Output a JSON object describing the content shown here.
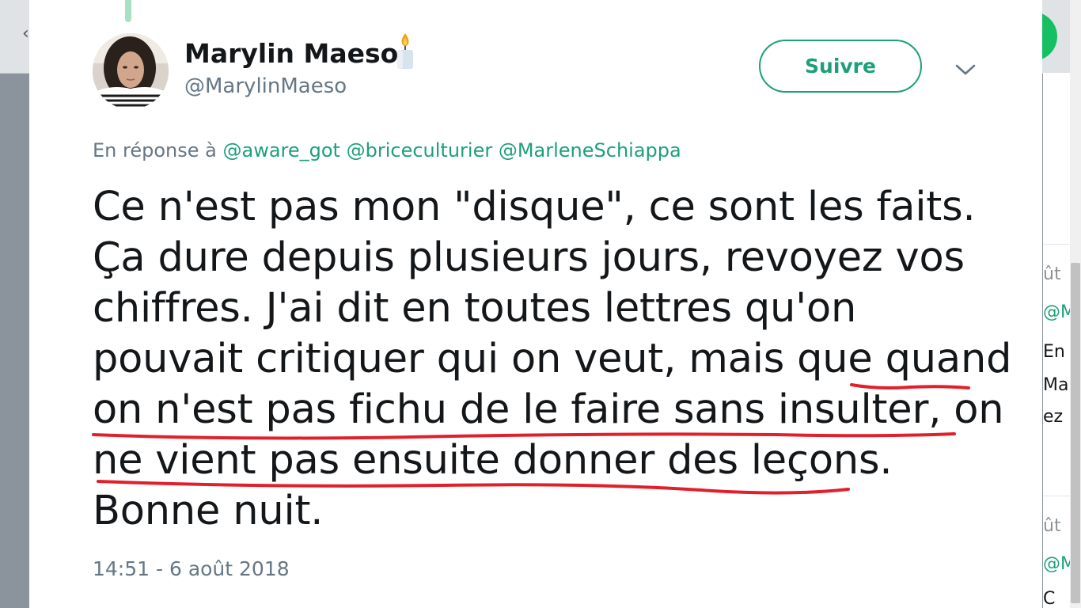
{
  "tweet": {
    "author_name": "Marylin Maeso",
    "author_handle": "@MarylinMaeso",
    "follow_label": "Suivre",
    "reply_prefix": "En réponse à",
    "reply_mentions": [
      "@aware_got",
      "@briceculturier",
      "@MarleneSchiappa"
    ],
    "text_lines": [
      "Ce n'est pas mon \"disque\", ce sont les faits.",
      "Ça dure depuis plusieurs jours, revoyez vos",
      "chiffres. J'ai dit en toutes lettres qu'on",
      "pouvait critiquer qui on veut, mais que quand",
      "on n'est pas fichu de le faire sans insulter, on",
      "ne vient pas ensuite donner des leçons.",
      "Bonne nuit."
    ],
    "timestamp": "14:51 - 6 août 2018"
  },
  "background_right": {
    "fragments": [
      "ût",
      "@M",
      "En",
      "Ma",
      "ez r",
      "ût",
      "@M",
      "C"
    ]
  },
  "annotation": {
    "underline_color": "#e0202a"
  },
  "icons": {
    "display_name_emoji": "candle-icon",
    "menu": "chevron-down-icon"
  },
  "colors": {
    "accent": "#1da079",
    "text": "#14171a",
    "muted": "#657786"
  }
}
